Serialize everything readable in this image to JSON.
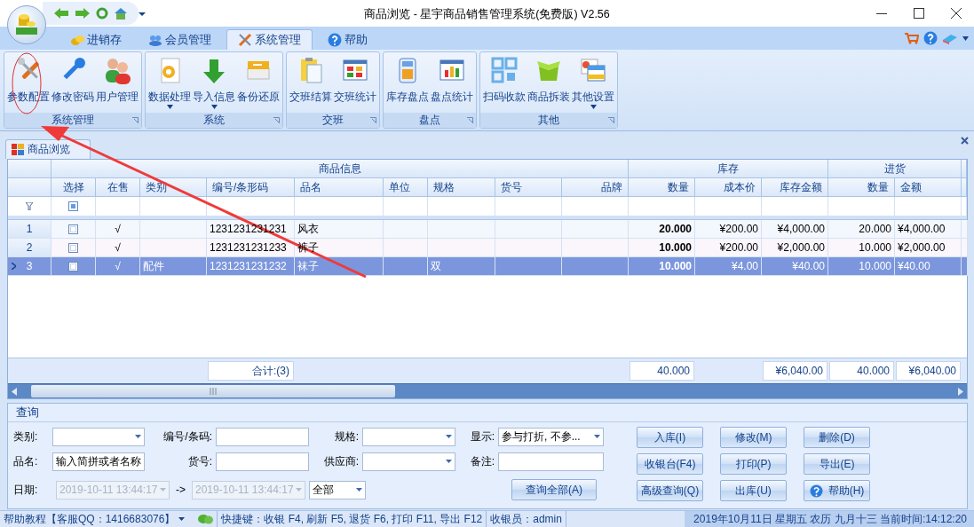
{
  "window": {
    "title": "商品浏览 - 星宇商品销售管理系统(免费版) V2.56"
  },
  "ribbon_tabs": [
    {
      "label": "进销存",
      "selected": false
    },
    {
      "label": "会员管理",
      "selected": false
    },
    {
      "label": "系统管理",
      "selected": true
    },
    {
      "label": "帮助",
      "selected": false
    }
  ],
  "ribbon_groups": [
    {
      "label": "系统管理",
      "buttons": [
        {
          "label": "参数配置",
          "dropdown": false
        },
        {
          "label": "修改密码",
          "dropdown": false
        },
        {
          "label": "用户管理",
          "dropdown": false
        }
      ]
    },
    {
      "label": "系统",
      "buttons": [
        {
          "label": "数据处理",
          "dropdown": true
        },
        {
          "label": "导入信息",
          "dropdown": true
        },
        {
          "label": "备份还原",
          "dropdown": false
        }
      ]
    },
    {
      "label": "交班",
      "buttons": [
        {
          "label": "交班结算",
          "dropdown": false
        },
        {
          "label": "交班统计",
          "dropdown": false
        }
      ]
    },
    {
      "label": "盘点",
      "buttons": [
        {
          "label": "库存盘点",
          "dropdown": false
        },
        {
          "label": "盘点统计",
          "dropdown": false
        }
      ]
    },
    {
      "label": "其他",
      "buttons": [
        {
          "label": "扫码收款",
          "dropdown": false
        },
        {
          "label": "商品拆装",
          "dropdown": false
        },
        {
          "label": "其他设置",
          "dropdown": true
        }
      ]
    }
  ],
  "document_tab": {
    "label": "商品浏览"
  },
  "grid": {
    "column_groups": [
      {
        "label": "商品信息",
        "columns": [
          "选择",
          "在售",
          "类别",
          "编号/条形码",
          "品名",
          "单位",
          "规格",
          "货号",
          "品牌"
        ]
      },
      {
        "label": "库存",
        "columns": [
          "数量",
          "成本价",
          "库存金额"
        ]
      },
      {
        "label": "进货",
        "columns": [
          "数量",
          "金额"
        ]
      }
    ],
    "rows": [
      {
        "number": "1",
        "selected": false,
        "checked": false,
        "cells": [
          "√",
          null,
          "1231231231231",
          "风衣",
          null,
          null,
          null,
          null,
          "20.000",
          "¥200.00",
          "¥4,000.00",
          "20.000",
          "¥4,000.00"
        ]
      },
      {
        "number": "2",
        "selected": false,
        "checked": false,
        "cells": [
          "√",
          null,
          "1231231231233",
          "裤子",
          null,
          null,
          null,
          null,
          "10.000",
          "¥200.00",
          "¥2,000.00",
          "10.000",
          "¥2,000.00"
        ]
      },
      {
        "number": "3",
        "selected": true,
        "checked": false,
        "cells": [
          "√",
          "配件",
          "1231231231232",
          "袜子",
          null,
          "双",
          null,
          null,
          "10.000",
          "¥4.00",
          "¥40.00",
          "10.000",
          "¥40.00"
        ]
      }
    ],
    "footer": {
      "count": "合计:(3)",
      "stock_quantity": "40.000",
      "stock_amount": "¥6,040.00",
      "purchase_quantity": "40.000",
      "purchase_amount": "¥6,040.00"
    }
  },
  "query": {
    "title": "查询",
    "fields": [
      {
        "label": "类别:",
        "kind": "dropdown"
      },
      {
        "label": "编号/条码:",
        "kind": "text"
      },
      {
        "label": "规格:",
        "kind": "dropdown"
      },
      {
        "label": "显示:",
        "kind": "dropdown",
        "value": "参与打折, 不参..."
      },
      {
        "label": "品名:",
        "kind": "text",
        "value": "输入简拼或者名称"
      },
      {
        "label": "货号:",
        "kind": "text"
      },
      {
        "label": "供应商:",
        "kind": "dropdown"
      },
      {
        "label": "备注:",
        "kind": "text"
      }
    ],
    "date": {
      "label": "日期:",
      "from": "2019-10-11 13:44:17",
      "separator": "->",
      "to": "2019-10-11 13:44:17",
      "disabled": true,
      "period": "全部"
    },
    "query_all_button": "查询全部(A)"
  },
  "action_buttons": [
    {
      "label": "入库(I)",
      "kind": "plain"
    },
    {
      "label": "修改(M)",
      "kind": "plain"
    },
    {
      "label": "删除(D)",
      "kind": "plain"
    },
    {
      "label": "收银台(F4)",
      "kind": "plain"
    },
    {
      "label": "打印(P)",
      "kind": "plain"
    },
    {
      "label": "导出(E)",
      "kind": "plain"
    },
    {
      "label": "高级查询(Q)",
      "kind": "plain"
    },
    {
      "label": "出库(U)",
      "kind": "plain"
    },
    {
      "label": "帮助(H)",
      "kind": "help"
    }
  ],
  "status_bar": {
    "help": "帮助教程【客服QQ：1416683076】",
    "shortcuts": "快捷键：收银 F4, 刷新 F5, 退货 F6, 打印 F11, 导出 F12",
    "cashier": "收银员：admin",
    "datetime": "2019年10月11日 星期五 农历 九月十三 当前时间:14:12:20"
  }
}
